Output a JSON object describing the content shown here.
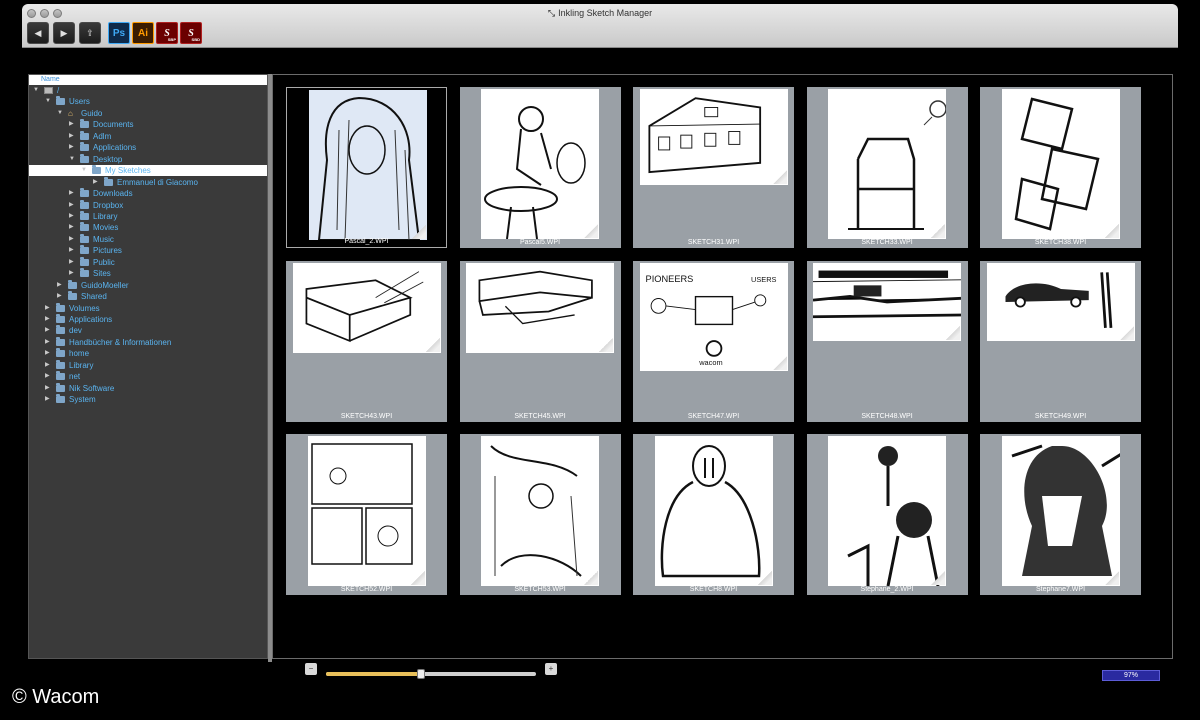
{
  "window": {
    "title": "Inkling Sketch Manager",
    "title_icon": "wacom-logo-icon"
  },
  "toolbar": {
    "buttons": [
      {
        "name": "back-button",
        "glyph": "◀",
        "icon": "arrow-left-icon"
      },
      {
        "name": "forward-button",
        "glyph": "▶",
        "icon": "arrow-right-icon"
      },
      {
        "name": "export-button",
        "glyph": "⇪",
        "icon": "export-icon"
      }
    ],
    "apps": [
      {
        "name": "photoshop-button",
        "label": "Ps",
        "icon": "photoshop-icon"
      },
      {
        "name": "illustrator-button",
        "label": "Ai",
        "icon": "illustrator-icon"
      },
      {
        "name": "sketchbook-pro-button",
        "label": "S",
        "badge": "SBP",
        "icon": "sketchbook-pro-icon"
      },
      {
        "name": "sketchbook-designer-button",
        "label": "S",
        "badge": "SBD",
        "icon": "sketchbook-designer-icon"
      }
    ]
  },
  "sidebar": {
    "header": "Name",
    "tree": [
      {
        "label": "/",
        "depth": 0,
        "expanded": true,
        "kind": "disk"
      },
      {
        "label": "Users",
        "depth": 1,
        "expanded": true,
        "kind": "folder"
      },
      {
        "label": "Guido",
        "depth": 2,
        "expanded": true,
        "kind": "home"
      },
      {
        "label": "Documents",
        "depth": 3,
        "expanded": false,
        "kind": "folder"
      },
      {
        "label": "Adlm",
        "depth": 3,
        "expanded": false,
        "kind": "folder"
      },
      {
        "label": "Applications",
        "depth": 3,
        "expanded": false,
        "kind": "folder"
      },
      {
        "label": "Desktop",
        "depth": 3,
        "expanded": true,
        "kind": "folder"
      },
      {
        "label": "My Sketches",
        "depth": 4,
        "expanded": true,
        "kind": "folder",
        "selected": true
      },
      {
        "label": "Emmanuel di Giacomo",
        "depth": 5,
        "expanded": false,
        "kind": "folder"
      },
      {
        "label": "Downloads",
        "depth": 3,
        "expanded": false,
        "kind": "folder"
      },
      {
        "label": "Dropbox",
        "depth": 3,
        "expanded": false,
        "kind": "folder"
      },
      {
        "label": "Library",
        "depth": 3,
        "expanded": false,
        "kind": "folder"
      },
      {
        "label": "Movies",
        "depth": 3,
        "expanded": false,
        "kind": "folder"
      },
      {
        "label": "Music",
        "depth": 3,
        "expanded": false,
        "kind": "folder"
      },
      {
        "label": "Pictures",
        "depth": 3,
        "expanded": false,
        "kind": "folder"
      },
      {
        "label": "Public",
        "depth": 3,
        "expanded": false,
        "kind": "folder"
      },
      {
        "label": "Sites",
        "depth": 3,
        "expanded": false,
        "kind": "folder"
      },
      {
        "label": "GuidoMoeller",
        "depth": 2,
        "expanded": false,
        "kind": "folder"
      },
      {
        "label": "Shared",
        "depth": 2,
        "expanded": false,
        "kind": "folder"
      },
      {
        "label": "Volumes",
        "depth": 1,
        "expanded": false,
        "kind": "folder"
      },
      {
        "label": "Applications",
        "depth": 1,
        "expanded": false,
        "kind": "folder"
      },
      {
        "label": "dev",
        "depth": 1,
        "expanded": false,
        "kind": "folder"
      },
      {
        "label": "Handbücher & Informationen",
        "depth": 1,
        "expanded": false,
        "kind": "folder"
      },
      {
        "label": "home",
        "depth": 1,
        "expanded": false,
        "kind": "folder"
      },
      {
        "label": "Library",
        "depth": 1,
        "expanded": false,
        "kind": "folder"
      },
      {
        "label": "net",
        "depth": 1,
        "expanded": false,
        "kind": "folder"
      },
      {
        "label": "Nik Software",
        "depth": 1,
        "expanded": false,
        "kind": "folder"
      },
      {
        "label": "System",
        "depth": 1,
        "expanded": false,
        "kind": "folder"
      }
    ]
  },
  "grid": {
    "thumbnails": [
      {
        "file": "Pascal_2.WPI",
        "selected": true,
        "orient": "portrait",
        "motif": "hooded-portrait"
      },
      {
        "file": "Pascal5.WPI",
        "orient": "portrait",
        "motif": "girl-on-mushroom"
      },
      {
        "file": "SKETCH31.WPI",
        "orient": "landscape",
        "motif": "house"
      },
      {
        "file": "SKETCH33.WPI",
        "orient": "portrait",
        "motif": "chair"
      },
      {
        "file": "SKETCH38.WPI",
        "orient": "portrait",
        "motif": "cubes"
      },
      {
        "file": "SKETCH43.WPI",
        "orient": "landscape",
        "motif": "box"
      },
      {
        "file": "SKETCH45.WPI",
        "orient": "landscape",
        "motif": "sofa"
      },
      {
        "file": "SKETCH47.WPI",
        "orient": "landscape",
        "motif": "diagram"
      },
      {
        "file": "SKETCH48.WPI",
        "orient": "landscape",
        "motif": "seascape"
      },
      {
        "file": "SKETCH49.WPI",
        "orient": "landscape",
        "motif": "car"
      },
      {
        "file": "SKETCH52.WPI",
        "orient": "portrait",
        "motif": "comic"
      },
      {
        "file": "SKETCH53.WPI",
        "orient": "portrait",
        "motif": "forest"
      },
      {
        "file": "SKETCH8.WPI",
        "orient": "portrait",
        "motif": "cloaked-figure"
      },
      {
        "file": "Stephane_2.WPI",
        "orient": "portrait",
        "motif": "figures"
      },
      {
        "file": "Stephane7.WPI",
        "orient": "portrait",
        "motif": "old-man"
      }
    ]
  },
  "footer": {
    "zoom_out_glyph": "−",
    "zoom_in_glyph": "+",
    "zoom_level": 0.45,
    "progress_label": "97%",
    "progress_value": 0.97
  },
  "watermark": "© Wacom",
  "colors": {
    "folder_label": "#5ab4f0",
    "sidebar_bg": "#3a3a3a",
    "tile_bg": "#9aa0a6",
    "progress": "#2a2aa0",
    "slider_fill": "#e9c05a"
  }
}
